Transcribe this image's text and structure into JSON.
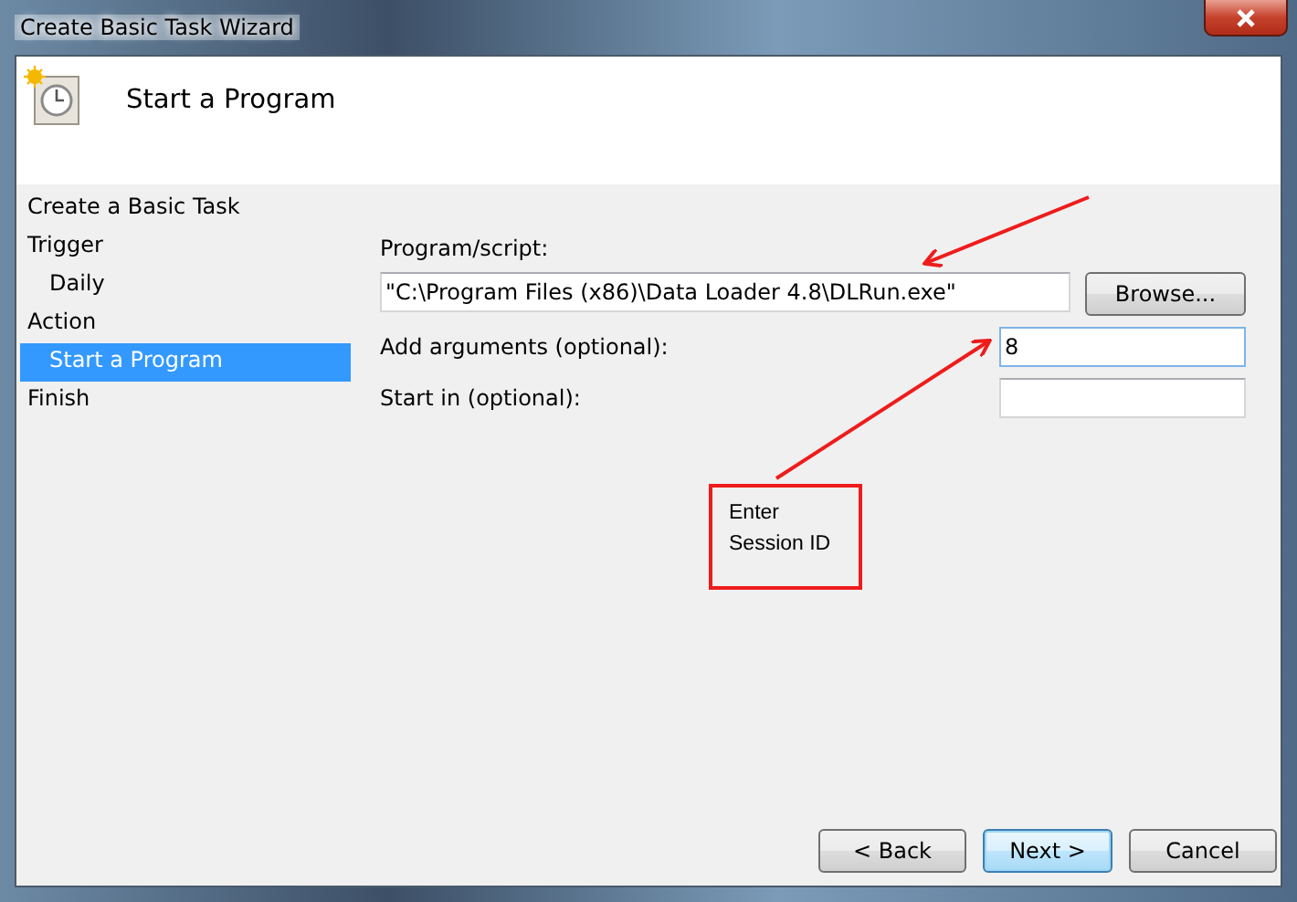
{
  "window": {
    "title": "Create Basic Task Wizard"
  },
  "header": {
    "title": "Start a Program"
  },
  "steps": [
    {
      "label": "Create a Basic Task",
      "selected": false
    },
    {
      "label": "Trigger",
      "selected": false,
      "children": [
        {
          "label": "Daily",
          "selected": false
        }
      ]
    },
    {
      "label": "Action",
      "selected": false,
      "children": [
        {
          "label": "Start a Program",
          "selected": true
        }
      ]
    },
    {
      "label": "Finish",
      "selected": false
    }
  ],
  "form": {
    "program_label": "Program/script:",
    "program_value": "\"C:\\Program Files (x86)\\Data Loader 4.8\\DLRun.exe\"",
    "browse": "Browse...",
    "arguments_label": "Add arguments (optional):",
    "arguments_value": "8",
    "start_in_label": "Start in (optional):"
  },
  "annotation": {
    "lines": [
      "Enter",
      "Session ID"
    ]
  },
  "buttons": [
    {
      "label": "< Back",
      "kind": "normal"
    },
    {
      "label": "Next >",
      "kind": "default"
    },
    {
      "label": "Cancel",
      "kind": "normal"
    }
  ]
}
